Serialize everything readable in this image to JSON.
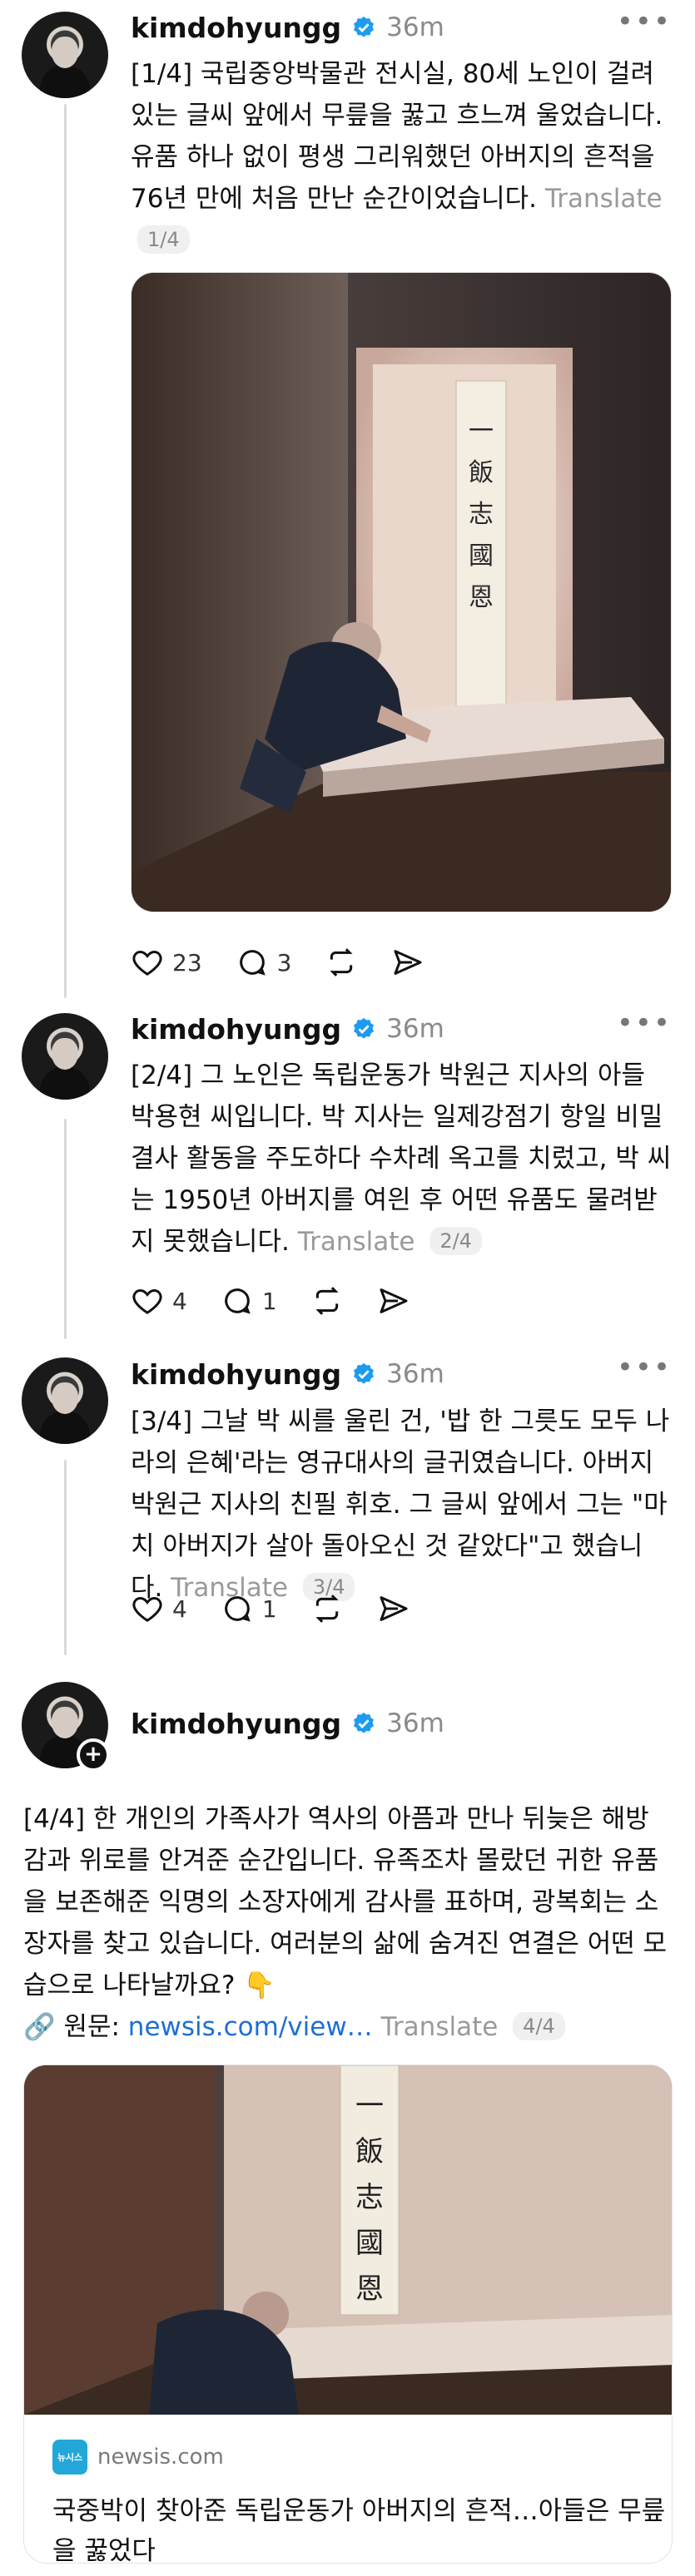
{
  "author": {
    "username": "kimdohyungg",
    "verified_icon": "verified-badge-icon",
    "more_icon": "more-horizontal-icon"
  },
  "colors": {
    "verified_blue": "#1d9bf0",
    "link_blue": "#1d6fd6",
    "muted": "#8a8a8a"
  },
  "posts": [
    {
      "time": "36m",
      "text": "[1/4] 국립중앙박물관 전시실, 80세 노인이 걸려있는 글씨 앞에서 무릎을 꿇고 흐느껴 울었습니다. 유품 하나 없이 평생 그리워했던 아버지의 흔적을 76년 만에 처음 만난 순간이었습니다.",
      "translate": "Translate",
      "pager": "1/4",
      "likes": "23",
      "replies": "3"
    },
    {
      "time": "36m",
      "text": "[2/4] 그 노인은 독립운동가 박원근 지사의 아들 박용현 씨입니다. 박 지사는 일제강점기 항일 비밀결사 활동을 주도하다 수차례 옥고를 치렀고, 박 씨는 1950년 아버지를 여읜 후 어떤 유품도 물려받지 못했습니다.",
      "translate": "Translate",
      "pager": "2/4",
      "likes": "4",
      "replies": "1"
    },
    {
      "time": "36m",
      "text": "[3/4] 그날 박 씨를 울린 건, '밥 한 그릇도 모두 나라의 은혜'라는 영규대사의 글귀였습니다. 아버지 박원근 지사의 친필 휘호. 그 글씨 앞에서 그는 \"마치 아버지가 살아 돌아오신 것 같았다\"고 했습니다.",
      "translate": "Translate",
      "pager": "3/4",
      "likes": "4",
      "replies": "1"
    },
    {
      "time": "36m",
      "text": "[4/4] 한 개인의 가족사가 역사의 아픔과 만나 뒤늦은 해방감과 위로를 안겨준 순간입니다. 유족조차 몰랐던 귀한 유품을 보존해준 익명의 소장자에게 감사를 표하며, 광복회는 소장자를 찾고 있습니다. 여러분의 삶에 숨겨진 연결은 어떤 모습으로 나타날까요? 👇",
      "source_prefix": "🔗 원문: ",
      "source_link": "newsis.com/view…",
      "translate": "Translate",
      "pager": "4/4",
      "card": {
        "logo": "뉴시스",
        "domain": "newsis.com",
        "title": "국중박이 찾아준 독립운동가 아버지의 흔적…아들은 무릎을 꿇었다"
      }
    }
  ],
  "action_icons": [
    "heart-icon",
    "reply-icon",
    "repost-icon",
    "share-icon"
  ]
}
